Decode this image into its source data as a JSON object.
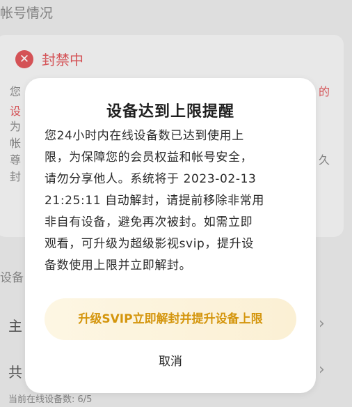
{
  "background": {
    "section_title": "帐号情况",
    "ban_icon": "✕",
    "ban_status": "封禁中",
    "card_fragments": [
      "您",
      "设",
      "为",
      "帐",
      "尊",
      "封"
    ],
    "card_fragment_right": "的",
    "card_fragment_right2": "久",
    "devices_heading": "设备",
    "rows": [
      {
        "label": "主"
      },
      {
        "label": "共"
      }
    ],
    "footer": "当前在线设备数: 6/5"
  },
  "dialog": {
    "title": "设备达到上限提醒",
    "body_lines": [
      "您24小时内在线设备数已达到使用上",
      "限，为保障您的会员权益和帐号安全，",
      "请勿分享他人。系统将于 2023-02-13",
      "21:25:11 自动解封，请提前移除非常用",
      "非自有设备，避免再次被封。如需立即",
      "观看，可升级为超级影视svip，提升设",
      "备数使用上限并立即解封。"
    ],
    "upgrade_button": "升级SVIP立即解封并提升设备上限",
    "cancel_button": "取消"
  },
  "colors": {
    "danger": "#e2585c",
    "upgrade_text": "#d4950c",
    "upgrade_bg": "#fdf6e3"
  }
}
